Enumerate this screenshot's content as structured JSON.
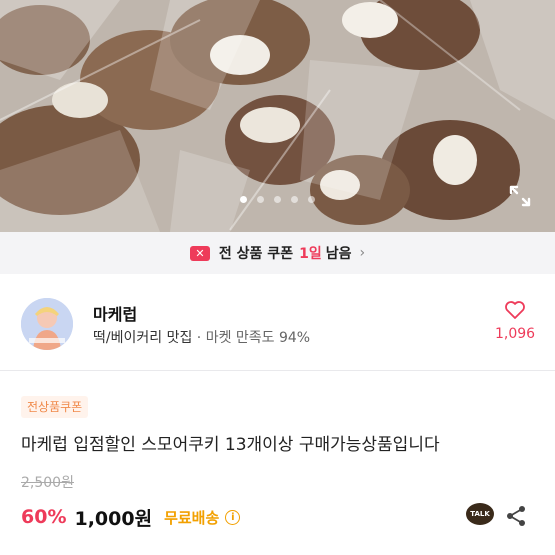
{
  "carousel": {
    "dot_count": 5,
    "active_index": 0
  },
  "coupon_banner": {
    "icon_glyph": "✕",
    "text": "전 상품 쿠폰",
    "days": "1일",
    "suffix": "남음",
    "chevron": "›"
  },
  "seller": {
    "name": "마케럽",
    "category": "떡/베이커리 맛집",
    "separator": " · ",
    "satisfaction": "마켓 만족도 94%",
    "like_count": "1,096"
  },
  "product": {
    "tag": "전상품쿠폰",
    "title": "마케럽 입점할인 스모어쿠키 13개이상 구매가능상품입니다",
    "original_price": "2,500원",
    "discount": "60%",
    "price": "1,000원",
    "shipping": "무료배송",
    "info_glyph": "i"
  },
  "actions": {
    "talk_label": "TALK"
  },
  "colors": {
    "accent": "#ee3b5a",
    "shipping": "#f2a000",
    "tag_text": "#f08a4b",
    "tag_bg": "#fff3ec"
  }
}
